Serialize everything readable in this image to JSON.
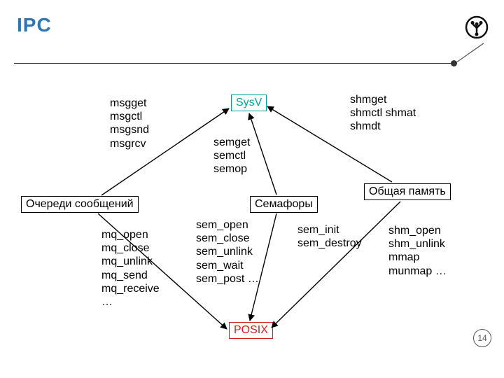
{
  "title": "IPC",
  "page_number": "14",
  "nodes": {
    "top": "SysV",
    "bottom": "POSIX",
    "left": "Очереди сообщений",
    "mid": "Семафоры",
    "right": "Общая память"
  },
  "blocks": {
    "msg_sysv": "msgget msgctl msgsnd msgrcv",
    "sem_sysv": "semget semctl semop",
    "shm_sysv": "shmget shmctl shmat shmdt",
    "mq_posix": "mq_open mq_close mq_unlink mq_send mq_receive …",
    "sem_named_posix": "sem_open sem_close sem_unlink sem_wait sem_post …",
    "sem_unnamed_posix": "sem_init sem_destroy",
    "shm_posix": "shm_open shm_unlink mmap munmap …"
  }
}
